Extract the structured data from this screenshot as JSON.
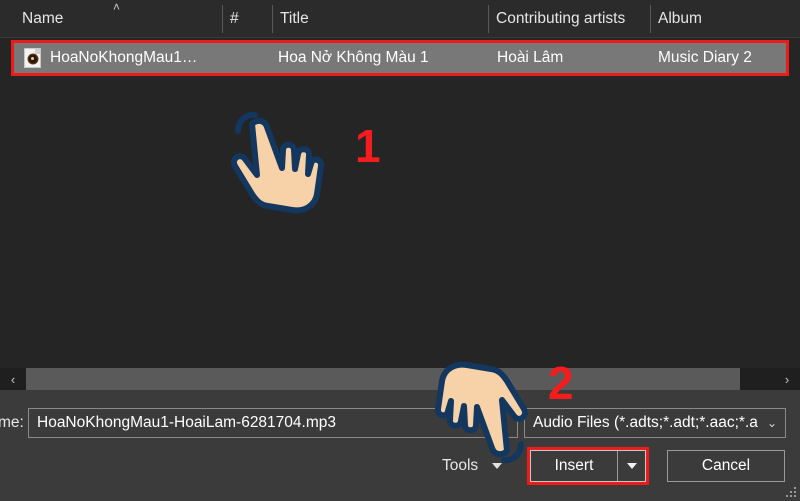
{
  "file_list": {
    "columns": [
      {
        "label": "Name",
        "sort_indicator": "˄"
      },
      {
        "label": "#"
      },
      {
        "label": "Title"
      },
      {
        "label": "Contributing artists"
      },
      {
        "label": "Album"
      }
    ],
    "rows": [
      {
        "icon": "audio-file-icon",
        "name": "HoaNoKhongMau1…",
        "number": "",
        "title": "Hoa Nở Không Màu 1",
        "artist": "Hoài Lâm",
        "album": "Music Diary 2",
        "selected": true
      }
    ]
  },
  "scrollbar": {
    "left_arrow": "‹",
    "right_arrow": "›"
  },
  "footer": {
    "file_name_label": "me:",
    "file_name_value": "HoaNoKhongMau1-HoaiLam-6281704.mp3",
    "file_name_caret": "⌄",
    "file_type_value": "Audio Files (*.adts;*.adt;*.aac;*.a",
    "file_type_caret": "⌄",
    "tools_label": "Tools",
    "insert_label": "Insert",
    "cancel_label": "Cancel"
  },
  "annotations": {
    "step_one": "1",
    "step_two": "2"
  },
  "colors": {
    "annotation_red": "#f41c1c",
    "highlight_border": "#ee1b1b",
    "row_selected_bg": "#787878",
    "list_bg": "#252526",
    "footer_bg": "#3b3b3b",
    "cursor_fill": "#f7d2a8",
    "cursor_outline": "#13375e"
  }
}
